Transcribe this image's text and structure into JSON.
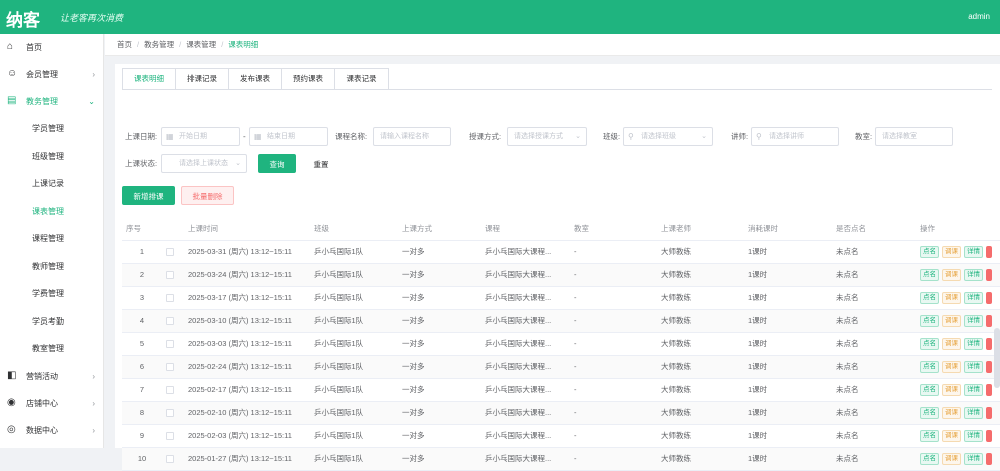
{
  "header": {
    "logo": "纳客",
    "slogan": "让老客再次消费",
    "user": "admin"
  },
  "sidebar": {
    "items": [
      {
        "icon": "home-icon",
        "glyph": "⌂",
        "label": "首页",
        "arrow": ""
      },
      {
        "icon": "member-icon",
        "glyph": "☺",
        "label": "会员管理",
        "arrow": "›"
      },
      {
        "icon": "book-icon",
        "glyph": "▤",
        "label": "教务管理",
        "arrow": "⌄"
      }
    ],
    "sub_items": [
      {
        "label": "学员管理"
      },
      {
        "label": "班级管理"
      },
      {
        "label": "上课记录"
      },
      {
        "label": "课表管理"
      },
      {
        "label": "课程管理"
      },
      {
        "label": "教师管理"
      },
      {
        "label": "学费管理"
      },
      {
        "label": "学员考勤"
      },
      {
        "label": "教室管理"
      }
    ],
    "bottom_items": [
      {
        "icon": "marketing-icon",
        "glyph": "◧",
        "label": "营销活动",
        "arrow": "›"
      },
      {
        "icon": "store-icon",
        "glyph": "◉",
        "label": "店铺中心",
        "arrow": "›"
      },
      {
        "icon": "data-icon",
        "glyph": "◎",
        "label": "数据中心",
        "arrow": "›"
      }
    ]
  },
  "breadcrumb": [
    "首页",
    "教务管理",
    "课表管理",
    "课表明细"
  ],
  "tabs": [
    "课表明细",
    "排课记录",
    "发布课表",
    "预约课表",
    "课表记录"
  ],
  "filters": {
    "date_label": "上课日期:",
    "date_start_ph": "开始日期",
    "date_sep": "-",
    "date_end_ph": "结束日期",
    "course_label": "课程名称:",
    "course_ph": "请输入课程名称",
    "mode_label": "授课方式:",
    "mode_ph": "请选择授课方式",
    "class_label": "班级:",
    "class_ph": "请选择班级",
    "teacher_label": "讲师:",
    "teacher_ph": "请选择讲师",
    "room_label": "教室:",
    "room_ph": "请选择教室",
    "status_label": "上课状态:",
    "status_ph": "请选择上课状态",
    "search_btn": "查询",
    "reset_btn": "重置"
  },
  "actions": {
    "add": "新增排课",
    "batch_delete": "批量删除"
  },
  "table": {
    "headers": [
      "序号",
      "",
      "上课时间",
      "班级",
      "上课方式",
      "课程",
      "教室",
      "上课老师",
      "消耗课时",
      "是否点名",
      "操作"
    ],
    "rows": [
      {
        "no": "1",
        "time": "2025-03-31 (周六) 13:12~15:11",
        "class": "乒小乓国际1队",
        "mode": "一对多",
        "course": "乒小乓国际大课程...",
        "room": "-",
        "teacher": "大师教练",
        "hours": "1课时",
        "rollcall": "未点名"
      },
      {
        "no": "2",
        "time": "2025-03-24 (周六) 13:12~15:11",
        "class": "乒小乓国际1队",
        "mode": "一对多",
        "course": "乒小乓国际大课程...",
        "room": "-",
        "teacher": "大师教练",
        "hours": "1课时",
        "rollcall": "未点名"
      },
      {
        "no": "3",
        "time": "2025-03-17 (周六) 13:12~15:11",
        "class": "乒小乓国际1队",
        "mode": "一对多",
        "course": "乒小乓国际大课程...",
        "room": "-",
        "teacher": "大师教练",
        "hours": "1课时",
        "rollcall": "未点名"
      },
      {
        "no": "4",
        "time": "2025-03-10 (周六) 13:12~15:11",
        "class": "乒小乓国际1队",
        "mode": "一对多",
        "course": "乒小乓国际大课程...",
        "room": "-",
        "teacher": "大师教练",
        "hours": "1课时",
        "rollcall": "未点名"
      },
      {
        "no": "5",
        "time": "2025-03-03 (周六) 13:12~15:11",
        "class": "乒小乓国际1队",
        "mode": "一对多",
        "course": "乒小乓国际大课程...",
        "room": "-",
        "teacher": "大师教练",
        "hours": "1课时",
        "rollcall": "未点名"
      },
      {
        "no": "6",
        "time": "2025-02-24 (周六) 13:12~15:11",
        "class": "乒小乓国际1队",
        "mode": "一对多",
        "course": "乒小乓国际大课程...",
        "room": "-",
        "teacher": "大师教练",
        "hours": "1课时",
        "rollcall": "未点名"
      },
      {
        "no": "7",
        "time": "2025-02-17 (周六) 13:12~15:11",
        "class": "乒小乓国际1队",
        "mode": "一对多",
        "course": "乒小乓国际大课程...",
        "room": "-",
        "teacher": "大师教练",
        "hours": "1课时",
        "rollcall": "未点名"
      },
      {
        "no": "8",
        "time": "2025-02-10 (周六) 13:12~15:11",
        "class": "乒小乓国际1队",
        "mode": "一对多",
        "course": "乒小乓国际大课程...",
        "room": "-",
        "teacher": "大师教练",
        "hours": "1课时",
        "rollcall": "未点名"
      },
      {
        "no": "9",
        "time": "2025-02-03 (周六) 13:12~15:11",
        "class": "乒小乓国际1队",
        "mode": "一对多",
        "course": "乒小乓国际大课程...",
        "room": "-",
        "teacher": "大师教练",
        "hours": "1课时",
        "rollcall": "未点名"
      },
      {
        "no": "10",
        "time": "2025-01-27 (周六) 13:12~15:11",
        "class": "乒小乓国际1队",
        "mode": "一对多",
        "course": "乒小乓国际大课程...",
        "room": "-",
        "teacher": "大师教练",
        "hours": "1课时",
        "rollcall": "未点名"
      }
    ],
    "ops": [
      "点名",
      "调课",
      "详情"
    ]
  },
  "colors": {
    "accent": "#1fb47f",
    "danger": "#f56c6c",
    "warning": "#e6a23c"
  }
}
